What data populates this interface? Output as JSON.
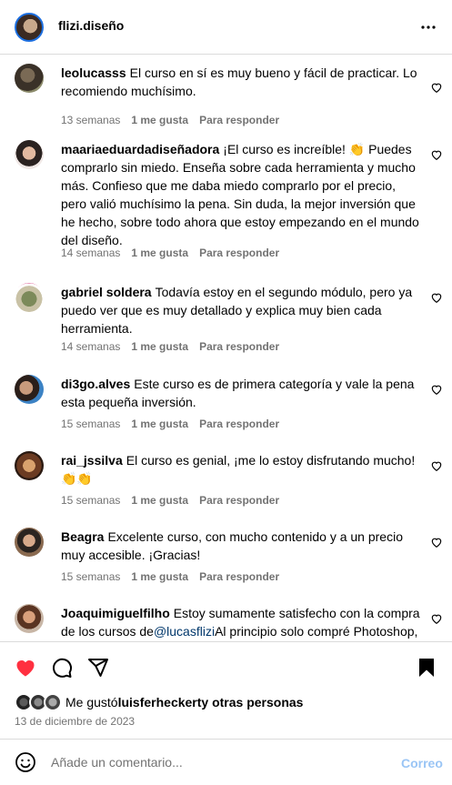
{
  "header": {
    "username": "flizi.diseño",
    "more_icon": "more-horizontal-icon"
  },
  "comments": [
    {
      "user": "leolucasss",
      "text": "El curso en sí es muy bueno y fácil de practicar. Lo recomiendo muchísimo.",
      "time": "13 semanas",
      "likes": "1 me gusta",
      "reply": "Para responder"
    },
    {
      "user": "maariaeduardadiseñadora",
      "text": "¡El curso es increíble! 👏 Puedes comprarlo sin miedo. Enseña sobre cada herramienta y mucho más. Confieso que me daba miedo comprarlo por el precio, pero valió muchísimo la pena. Sin duda, la mejor inversión que he hecho, sobre todo ahora que estoy empezando en el mundo del diseño.",
      "time": "14 semanas",
      "likes": "1 me gusta",
      "reply": "Para responder"
    },
    {
      "user": "gabriel soldera",
      "text": "Todavía estoy en el segundo módulo, pero ya puedo ver que es muy detallado y explica muy bien cada herramienta.",
      "time": "14 semanas",
      "likes": "1 me gusta",
      "reply": "Para responder"
    },
    {
      "user": "di3go.alves",
      "text": "Este curso es de primera categoría y vale la pena esta pequeña inversión.",
      "time": "15 semanas",
      "likes": "1 me gusta",
      "reply": "Para responder"
    },
    {
      "user": "rai_jssilva",
      "text": "El curso es genial, ¡me lo estoy disfrutando mucho! 👏👏",
      "time": "15 semanas",
      "likes": "1 me gusta",
      "reply": "Para responder"
    },
    {
      "user": "Beagra",
      "text": "Excelente curso, con mucho contenido y a un precio muy accesible. ¡Gracias!",
      "time": "15 semanas",
      "likes": "1 me gusta",
      "reply": "Para responder"
    },
    {
      "user": "Joaquimiguelfilho",
      "text_before": "Estoy sumamente satisfecho con la compra de los cursos de",
      "mention": "@lucasflizi",
      "text_after": "Al principio solo compré Photoshop,"
    }
  ],
  "actions": {
    "like_icon": "heart-filled-icon",
    "comment_icon": "comment-icon",
    "share_icon": "send-icon",
    "save_icon": "bookmark-icon",
    "like_color": "#ff3040"
  },
  "likes_line": {
    "prefix": "Me gustó ",
    "user": "luisferheckert",
    "suffix": " y otras personas"
  },
  "date": "13 de diciembre de 2023",
  "add_comment": {
    "placeholder": "Añade un comentario...",
    "post_label": "Correo",
    "emoji_icon": "emoji-icon"
  }
}
